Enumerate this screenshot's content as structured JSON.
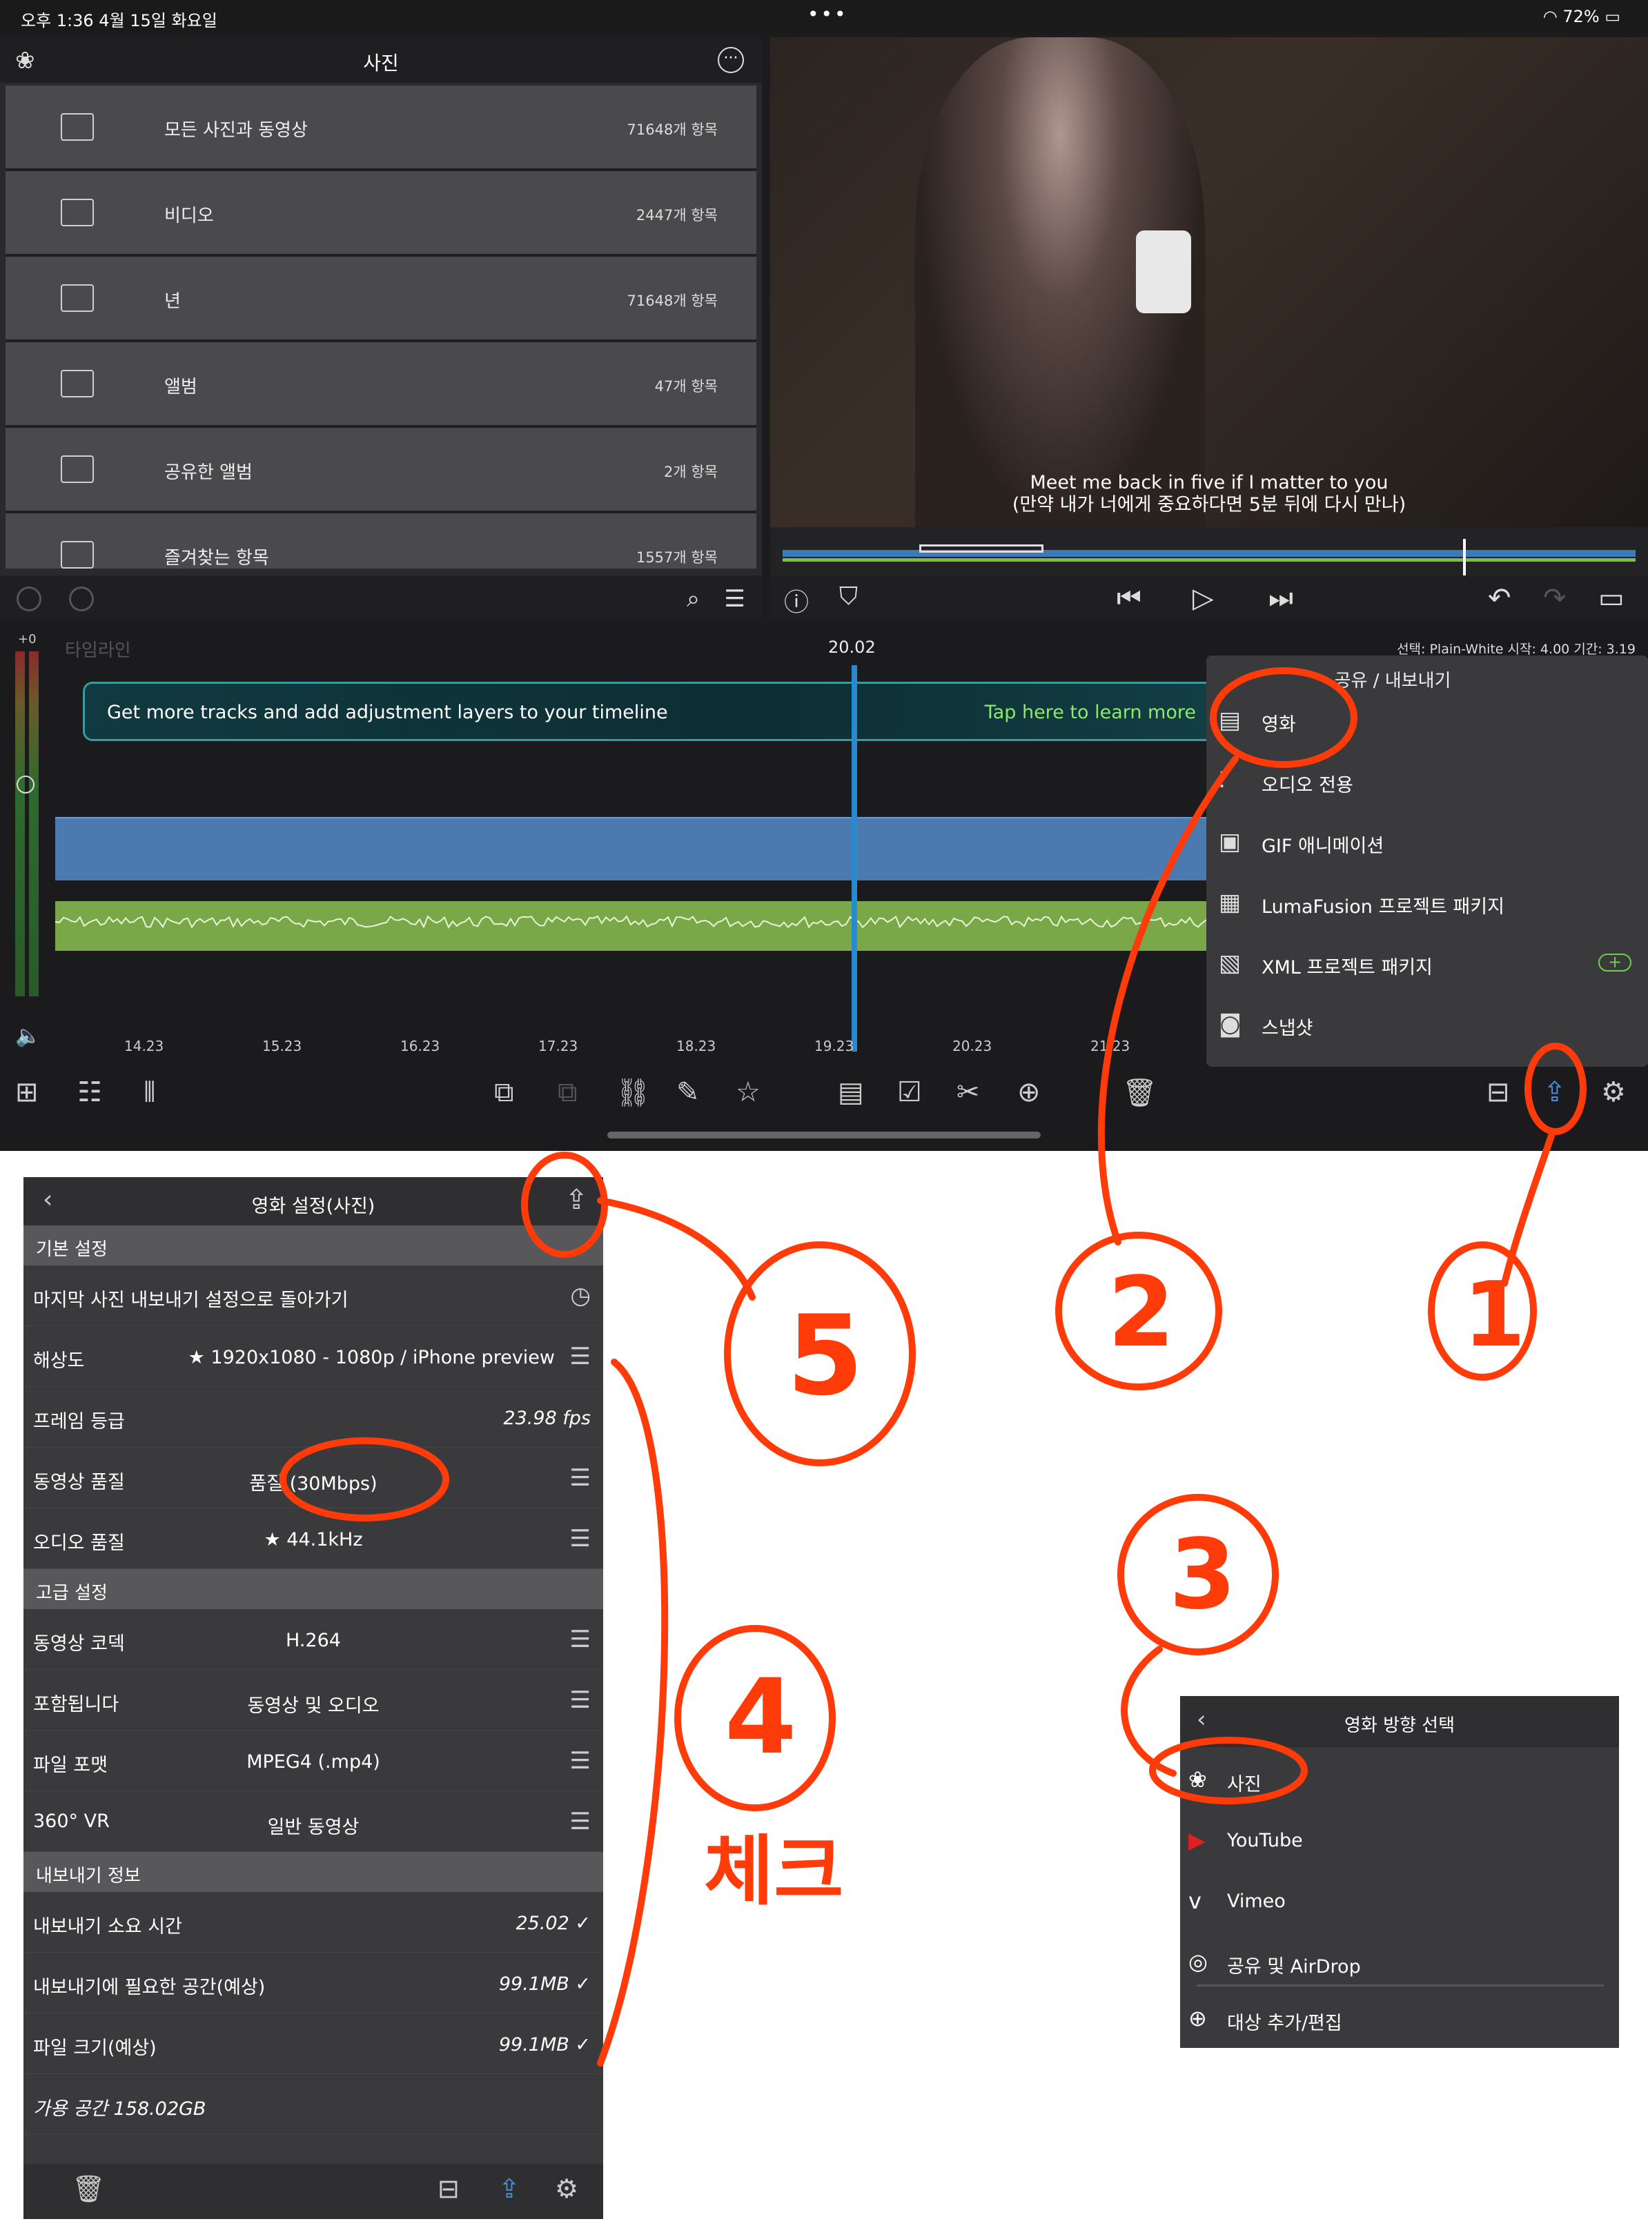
{
  "status_bar": {
    "time": "오후 1:36  4월 15일 화요일",
    "battery": "72%"
  },
  "library": {
    "title": "사진",
    "items": [
      {
        "label": "모든 사진과 동영상",
        "count": "71648개 항목",
        "icon": "folder-icon"
      },
      {
        "label": "비디오",
        "count": "2447개 항목",
        "icon": "video-camera-icon"
      },
      {
        "label": "년",
        "count": "71648개 항목",
        "icon": "calendar-clock-icon"
      },
      {
        "label": "앨범",
        "count": "47개 항목",
        "icon": "album-icon"
      },
      {
        "label": "공유한 앨범",
        "count": "2개 항목",
        "icon": "folder-icon"
      },
      {
        "label": "즐겨찾는 항목",
        "count": "1557개 항목",
        "icon": "heart-album-icon"
      }
    ]
  },
  "viewer": {
    "subtitle_en": "Meet me back in five if I matter to you",
    "subtitle_ko": "(만약 내가 너에게 중요하다면 5분 뒤에 다시 만나)"
  },
  "timeline": {
    "label": "타임라인",
    "level": "+0",
    "current_time": "20.02",
    "selection_info": "선택: Plain-White 시작: 4.00 기간: 3.19",
    "promo_text": "Get more tracks and add adjustment layers to your timeline",
    "promo_link": "Tap here to learn more",
    "ruler": [
      "14.23",
      "15.23",
      "16.23",
      "17.23",
      "18.23",
      "19.23",
      "20.23",
      "21.23"
    ]
  },
  "share_menu": {
    "title": "공유 / 내보내기",
    "items": [
      {
        "label": "영화",
        "icon": "film-icon"
      },
      {
        "label": "오디오 전용",
        "icon": "waveform-icon"
      },
      {
        "label": "GIF 애니메이션",
        "icon": "gif-icon"
      },
      {
        "label": "LumaFusion 프로젝트 패키지",
        "icon": "package-icon"
      },
      {
        "label": "XML 프로젝트 패키지",
        "icon": "clapper-icon"
      },
      {
        "label": "스냅샷",
        "icon": "camera-icon"
      }
    ]
  },
  "movie_settings": {
    "title": "영화 설정(사진)",
    "section_basic": "기본 설정",
    "reset_label": "마지막 사진 내보내기 설정으로 돌아가기",
    "resolution_label": "해상도",
    "resolution_value": "★ 1920x1080 - 1080p / iPhone preview",
    "framerate_label": "프레임 등급",
    "framerate_value": "23.98 fps",
    "video_quality_label": "동영상 품질",
    "video_quality_value": "품질 (30Mbps)",
    "audio_quality_label": "오디오 품질",
    "audio_quality_value": "★ 44.1kHz",
    "section_advanced": "고급 설정",
    "codec_label": "동영상 코덱",
    "codec_value": "H.264",
    "include_label": "포함됩니다",
    "include_value": "동영상 및 오디오",
    "format_label": "파일 포맷",
    "format_value": "MPEG4 (.mp4)",
    "vr_label": "360° VR",
    "vr_value": "일반 동영상",
    "section_info": "내보내기 정보",
    "time_label": "내보내기 소요 시간",
    "time_value": "25.02",
    "space_label": "내보내기에 필요한 공간(예상)",
    "space_value": "99.1MB",
    "size_label": "파일 크기(예상)",
    "size_value": "99.1MB",
    "available": "가용 공간 158.02GB"
  },
  "destination": {
    "title": "영화 방향 선택",
    "items": [
      {
        "label": "사진",
        "icon": "photos-flower-icon"
      },
      {
        "label": "YouTube",
        "icon": "youtube-icon"
      },
      {
        "label": "Vimeo",
        "icon": "vimeo-icon"
      },
      {
        "label": "공유 및 AirDrop",
        "icon": "airdrop-icon"
      }
    ],
    "add_label": "대상 추가/편집"
  },
  "annotations": {
    "step1": "1",
    "step2": "2",
    "step3": "3",
    "step4": "4",
    "step5": "5",
    "check_text": "체크",
    "color": "#ff3b0a"
  }
}
